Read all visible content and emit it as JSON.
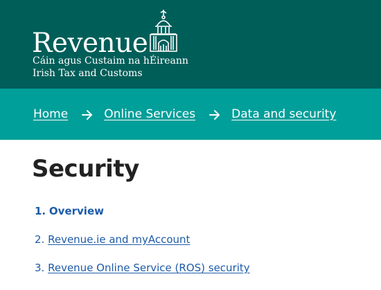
{
  "header": {
    "logo_word": "Revenue",
    "logo_line1": "Cáin agus Custaim na hÉireann",
    "logo_line2": "Irish Tax and Customs",
    "emblem_icon": "customs-house-icon"
  },
  "breadcrumb": {
    "items": [
      {
        "label": "Home"
      },
      {
        "label": "Online Services"
      },
      {
        "label": "Data and security"
      }
    ],
    "separator_icon": "arrow-right-icon"
  },
  "page": {
    "title": "Security"
  },
  "toc": {
    "items": [
      {
        "number": "1.",
        "label": "Overview",
        "current": true
      },
      {
        "number": "2.",
        "label": "Revenue.ie and myAccount",
        "current": false
      },
      {
        "number": "3.",
        "label": "Revenue Online Service (ROS) security",
        "current": false
      }
    ]
  },
  "colors": {
    "header_bg": "#005e59",
    "breadcrumb_bg": "#009f9a",
    "link": "#1d5ba8",
    "title": "#222222"
  }
}
